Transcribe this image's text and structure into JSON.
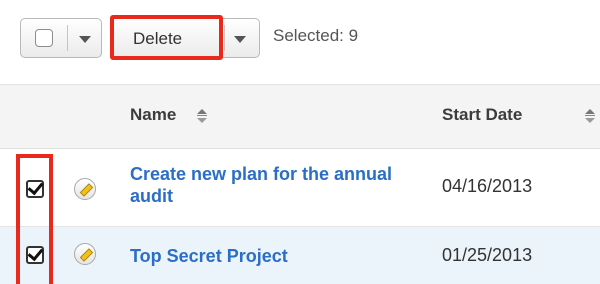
{
  "toolbar": {
    "delete_label": "Delete",
    "selected_text": "Selected: 9"
  },
  "table": {
    "columns": [
      {
        "label": "Name"
      },
      {
        "label": "Start Date"
      }
    ],
    "rows": [
      {
        "name": "Create new plan for the annual audit",
        "start_date": "04/16/2013",
        "checked": true
      },
      {
        "name": "Top Secret Project",
        "start_date": "01/25/2013",
        "checked": true
      }
    ]
  },
  "colors": {
    "highlight": "#e8291c",
    "link": "#2a6ec7",
    "selected_row": "#ebf3fb"
  },
  "icons": [
    "checkbox-icon",
    "chevron-down-icon",
    "sort-icon",
    "pencil-icon",
    "checkmark-icon"
  ]
}
